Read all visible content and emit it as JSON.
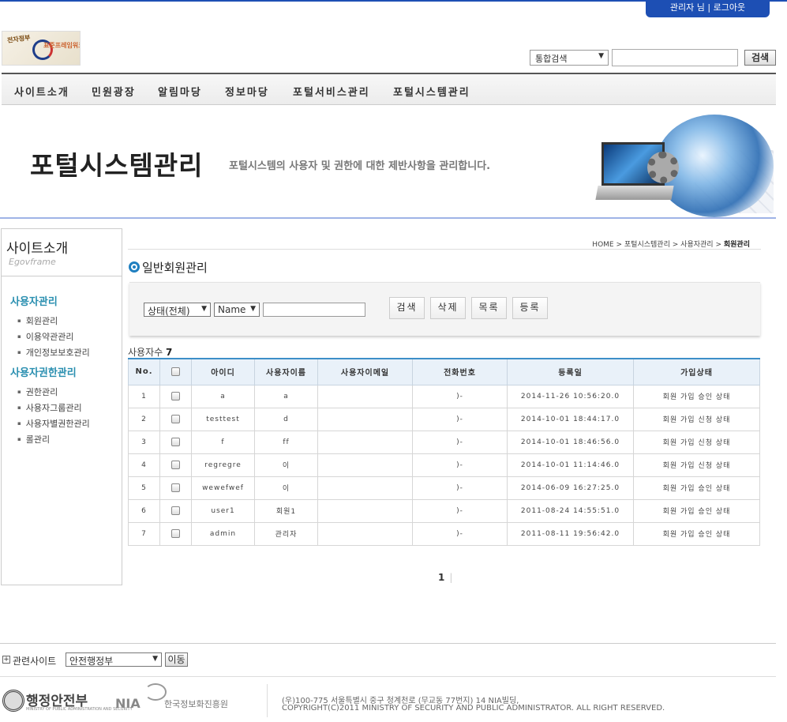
{
  "header": {
    "admin_name": "관리자 님",
    "divider": "|",
    "logout": "로그아웃",
    "logo_line1": "전자정부",
    "logo_line2": "표준프레임워크",
    "logo_line3": "",
    "search_scope": "통합검색",
    "search_button": "검색"
  },
  "nav": {
    "items": [
      "사이트소개",
      "민원광장",
      "알림마당",
      "정보마당",
      "포털서비스관리",
      "포털시스템관리"
    ]
  },
  "banner": {
    "title": "포털시스템관리",
    "subtitle": "포털시스템의 사용자 및 권한에 대한 제반사항을 관리합니다."
  },
  "sidebar": {
    "title": "사이트소개",
    "subtitle": "Egovframe",
    "groups": [
      {
        "heading": "사용자관리",
        "items": [
          "회원관리",
          "이용약관관리",
          "개인정보보호관리"
        ]
      },
      {
        "heading": "사용자권한관리",
        "items": [
          "권한관리",
          "사용자그룹관리",
          "사용자별권한관리",
          "롤관리"
        ]
      }
    ]
  },
  "breadcrumb": {
    "home": "HOME",
    "sep": ">",
    "level1": "포털시스템관리",
    "level2": "사용자관리",
    "current": "회원관리"
  },
  "page": {
    "title": "일반회원관리"
  },
  "search": {
    "status_value": "상태(전체)",
    "field_value": "Name",
    "keyword": "",
    "buttons": {
      "search": "검색",
      "delete": "삭제",
      "list": "목록",
      "register": "등록"
    }
  },
  "count": {
    "label": "사용자수",
    "value": "7"
  },
  "table": {
    "headers": [
      "No.",
      "",
      "아이디",
      "사용자이름",
      "사용자이메일",
      "전화번호",
      "등록일",
      "가입상태"
    ],
    "rows": [
      {
        "no": "1",
        "id": "a",
        "name": "a",
        "email": "",
        "phone": ")-",
        "date": "2014-11-26 10:56:20.0",
        "status": "회원 가입 승인 상태"
      },
      {
        "no": "2",
        "id": "testtest",
        "name": "d",
        "email": "",
        "phone": ")-",
        "date": "2014-10-01 18:44:17.0",
        "status": "회원 가입 신청 상태"
      },
      {
        "no": "3",
        "id": "f",
        "name": "ff",
        "email": "",
        "phone": ")-",
        "date": "2014-10-01 18:46:56.0",
        "status": "회원 가입 신청 상태"
      },
      {
        "no": "4",
        "id": "regregre",
        "name": "이",
        "email": "",
        "phone": ")-",
        "date": "2014-10-01 11:14:46.0",
        "status": "회원 가입 신청 상태"
      },
      {
        "no": "5",
        "id": "wewefwef",
        "name": "이",
        "email": "",
        "phone": ")-",
        "date": "2014-06-09 16:27:25.0",
        "status": "회원 가입 승인 상태"
      },
      {
        "no": "6",
        "id": "user1",
        "name": "회원1",
        "email": "",
        "phone": ")-",
        "date": "2011-08-24 14:55:51.0",
        "status": "회원 가입 승인 상태"
      },
      {
        "no": "7",
        "id": "admin",
        "name": "관리자",
        "email": "",
        "phone": ")-",
        "date": "2011-08-11 19:56:42.0",
        "status": "회원 가입 승인 상태"
      }
    ]
  },
  "pager": {
    "current": "1",
    "bar": "|"
  },
  "footer": {
    "related_label": "관련사이트",
    "related_value": "안전행정부",
    "go_button": "이동",
    "mopas_name": "행정안전부",
    "mopas_small": "MINISTRY OF PUBLIC ADMINISTRATION AND SECURITY",
    "nia_name": "NIA",
    "nia_kr": "한국정보화진흥원",
    "address": "(우)100-775 서울특별시 중구 청계천로 (무교동 77번지) 14 NIA빌딩,",
    "copyright": "COPYRIGHT(C)2011 MINISTRY OF SECURITY AND PUBLIC ADMINISTRATOR. ALL RIGHT RESERVED."
  },
  "colors": {
    "accent": "#1d4fb4",
    "sidebar_heading": "#2a8fb0",
    "table_header_bg": "#e9f1f9"
  }
}
